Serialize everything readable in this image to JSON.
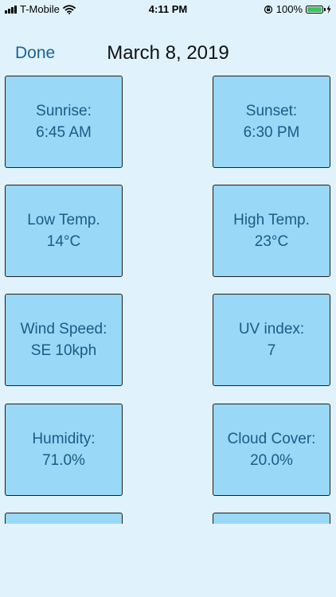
{
  "status_bar": {
    "carrier": "T-Mobile",
    "time": "4:11 PM",
    "battery_percent": "100%",
    "battery_level": 1.0
  },
  "nav": {
    "done_label": "Done",
    "title": "March 8, 2019"
  },
  "tiles": [
    {
      "label": "Sunrise:",
      "value": "6:45 AM"
    },
    {
      "label": "Sunset:",
      "value": "6:30 PM"
    },
    {
      "label": "Low Temp.",
      "value": "14°C"
    },
    {
      "label": "High Temp.",
      "value": "23°C"
    },
    {
      "label": "Wind Speed:",
      "value": "SE 10kph"
    },
    {
      "label": "UV index:",
      "value": "7"
    },
    {
      "label": "Humidity:",
      "value": "71.0%"
    },
    {
      "label": "Cloud Cover:",
      "value": "20.0%"
    }
  ],
  "colors": {
    "background": "#e0f3fc",
    "tile_fill": "#99d8f7",
    "tile_text": "#1e5a87",
    "accent": "#1d6296",
    "battery": "#34c759"
  }
}
